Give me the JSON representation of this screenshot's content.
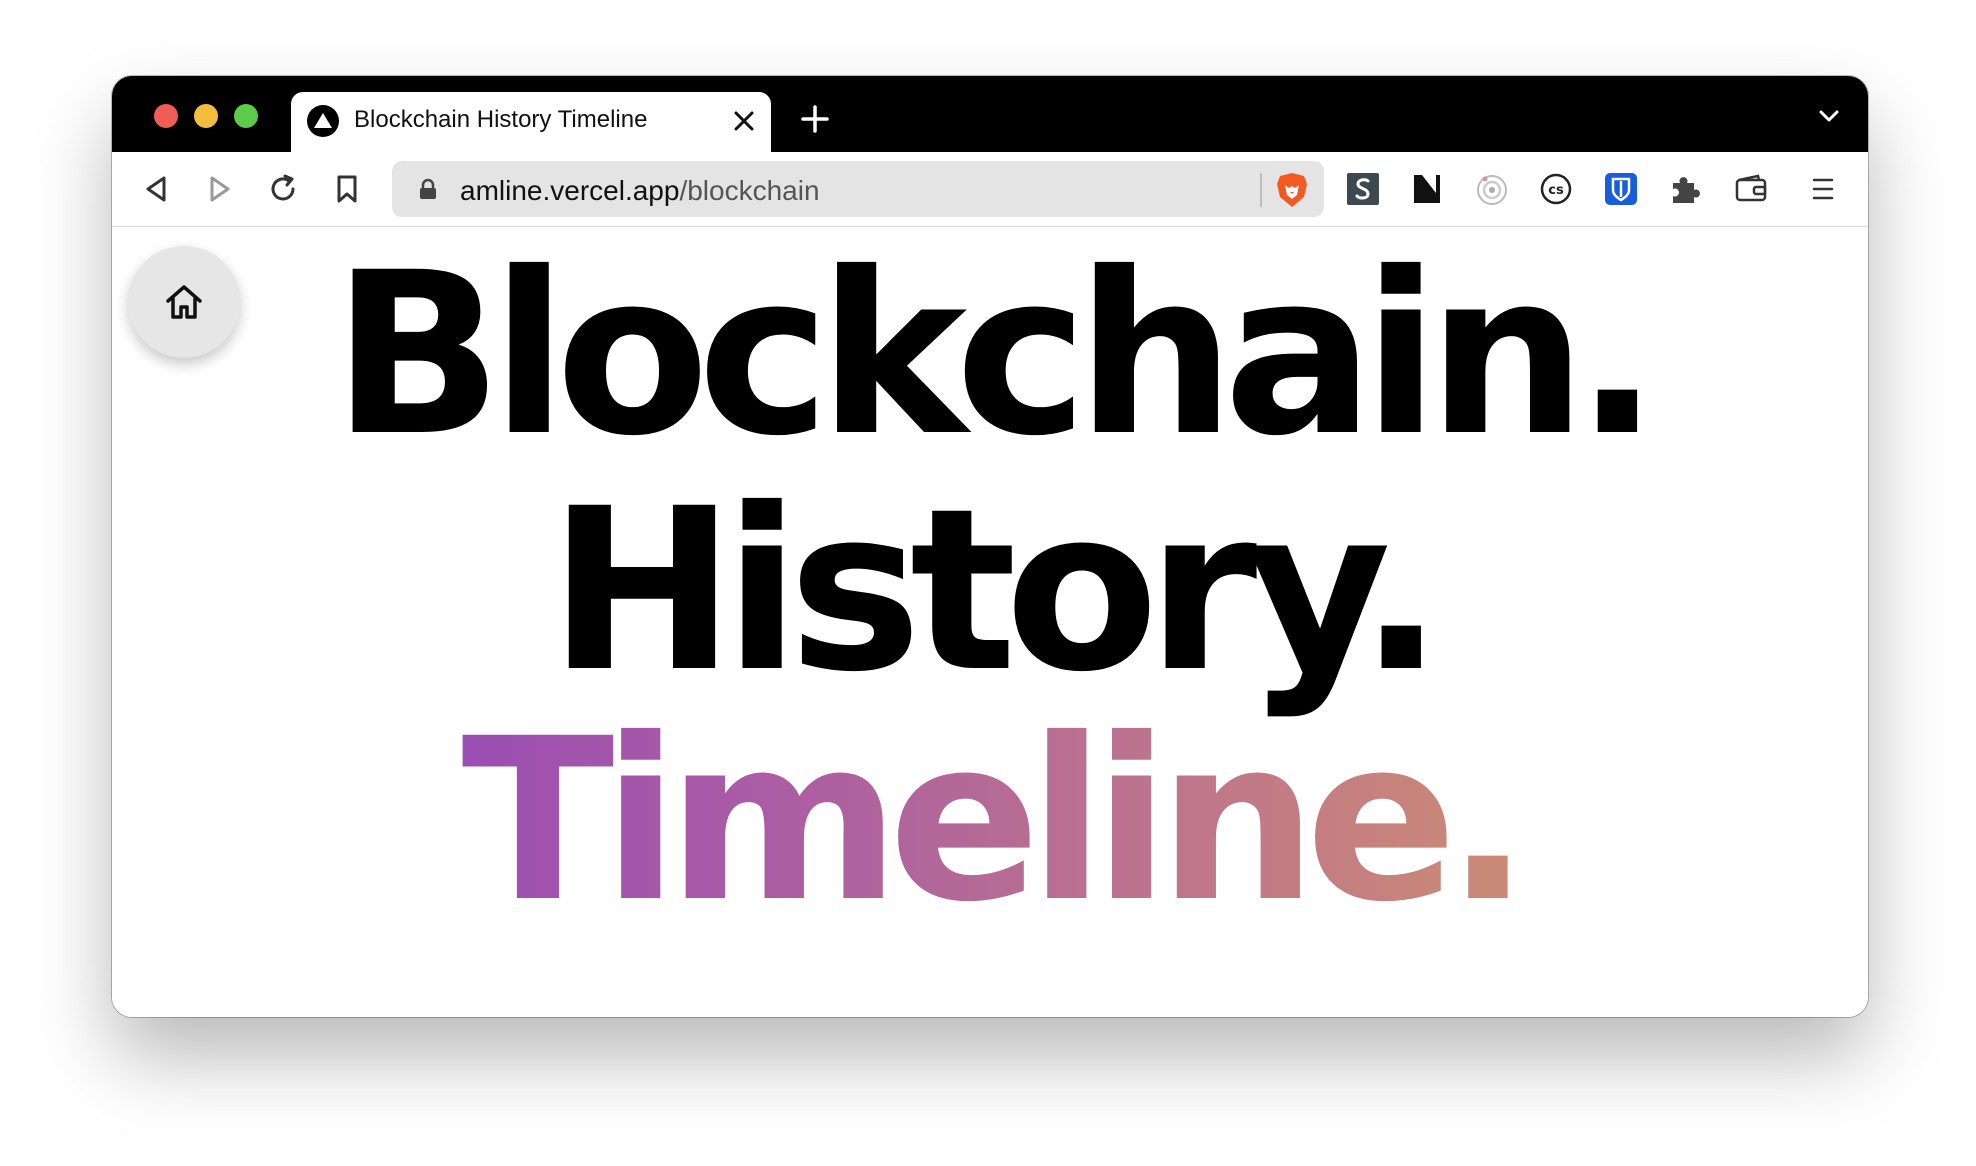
{
  "tab": {
    "title": "Blockchain History Timeline",
    "favicon": "vercel-triangle-icon"
  },
  "toolbar": {
    "url_host": "amline.vercel.app",
    "url_path": "/blockchain"
  },
  "extensions": [
    "s-extension-icon",
    "notion-icon",
    "record-icon",
    "cs-icon",
    "bitwarden-icon",
    "puzzle-icon",
    "wallet-icon",
    "menu-icon"
  ],
  "headline": {
    "line1": "Blockchain.",
    "line2": "History.",
    "line3": "Timeline."
  },
  "colors": {
    "gradient_start": "#8a3fc2",
    "gradient_end": "#d6a05e",
    "brave_orange": "#f25a22",
    "bitwarden_blue": "#175ddc"
  }
}
